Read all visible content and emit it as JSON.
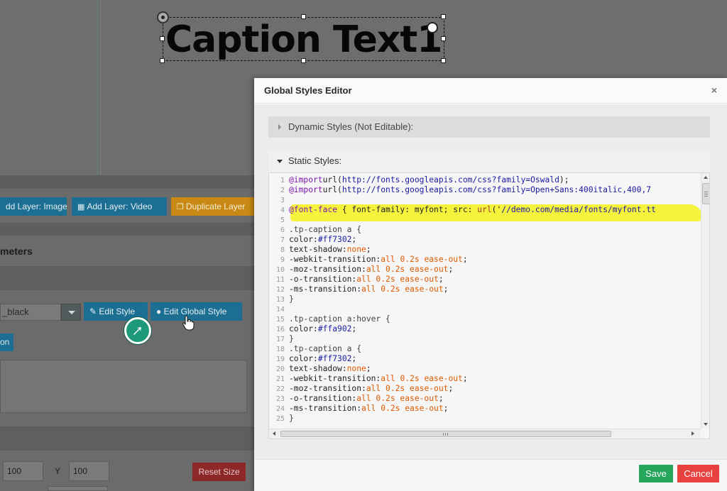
{
  "background": {
    "caption_text": "Caption Text1",
    "toolbar": {
      "add_layer_image": "dd Layer: Image",
      "add_layer_video": "Add Layer: Video",
      "duplicate_layer": "Duplicate Layer"
    },
    "section_title": "meters",
    "style_select_value": "_black",
    "edit_style": "Edit Style",
    "edit_global_style": "Edit Global Style",
    "partial_button": "on",
    "x_value": "100",
    "y_label": "Y",
    "y_value": "100",
    "reset_size": "Reset Size"
  },
  "modal": {
    "title": "Global Styles Editor",
    "close": "×",
    "dynamic_styles": "Dynamic Styles (Not Editable):",
    "static_styles": "Static Styles:",
    "save": "Save",
    "cancel": "Cancel",
    "code_lines": [
      [
        [
          "kw",
          "@import"
        ],
        [
          "",
          "url("
        ],
        [
          "url",
          "http://fonts.googleapis.com/css?family=Oswald"
        ],
        [
          "",
          ");"
        ]
      ],
      [
        [
          "kw",
          "@import"
        ],
        [
          "",
          "url("
        ],
        [
          "url",
          "http://fonts.googleapis.com/css?family=Open+Sans:400italic,400,7"
        ]
      ],
      [],
      [
        [
          "kw",
          "@font-face"
        ],
        [
          "",
          " { font-family: myfont; src: "
        ],
        [
          "str",
          "url"
        ],
        [
          "",
          "('"
        ],
        [
          "url",
          "//demo.com/media/fonts/myfont.tt"
        ]
      ],
      [],
      [
        [
          "sel",
          ".tp-caption a {"
        ]
      ],
      [
        [
          "prop",
          "color:"
        ],
        [
          "url",
          "#ff7302"
        ],
        [
          "",
          ";"
        ]
      ],
      [
        [
          "prop",
          "text-shadow:"
        ],
        [
          "num",
          "none"
        ],
        [
          "",
          ";"
        ]
      ],
      [
        [
          "prop",
          "-webkit-transition:"
        ],
        [
          "num",
          "all 0.2s ease-out"
        ],
        [
          "",
          ";"
        ]
      ],
      [
        [
          "prop",
          "-moz-transition:"
        ],
        [
          "num",
          "all 0.2s ease-out"
        ],
        [
          "",
          ";"
        ]
      ],
      [
        [
          "prop",
          "-o-transition:"
        ],
        [
          "num",
          "all 0.2s ease-out"
        ],
        [
          "",
          ";"
        ]
      ],
      [
        [
          "prop",
          "-ms-transition:"
        ],
        [
          "num",
          "all 0.2s ease-out"
        ],
        [
          "",
          ";"
        ]
      ],
      [
        [
          "sel",
          "}"
        ]
      ],
      [],
      [
        [
          "sel",
          ".tp-caption a:hover {"
        ]
      ],
      [
        [
          "prop",
          "color:"
        ],
        [
          "url",
          "#ffa902"
        ],
        [
          "",
          ";"
        ]
      ],
      [
        [
          "sel",
          "}"
        ]
      ],
      [
        [
          "sel",
          ".tp-caption a {"
        ]
      ],
      [
        [
          "prop",
          "color:"
        ],
        [
          "url",
          "#ff7302"
        ],
        [
          "",
          ";"
        ]
      ],
      [
        [
          "prop",
          "text-shadow:"
        ],
        [
          "num",
          "none"
        ],
        [
          "",
          ";"
        ]
      ],
      [
        [
          "prop",
          "-webkit-transition:"
        ],
        [
          "num",
          "all 0.2s ease-out"
        ],
        [
          "",
          ";"
        ]
      ],
      [
        [
          "prop",
          "-moz-transition:"
        ],
        [
          "num",
          "all 0.2s ease-out"
        ],
        [
          "",
          ";"
        ]
      ],
      [
        [
          "prop",
          "-o-transition:"
        ],
        [
          "num",
          "all 0.2s ease-out"
        ],
        [
          "",
          ";"
        ]
      ],
      [
        [
          "prop",
          "-ms-transition:"
        ],
        [
          "num",
          "all 0.2s ease-out"
        ],
        [
          "",
          ";"
        ]
      ],
      [
        [
          "sel",
          "}"
        ]
      ]
    ],
    "line_numbers": [
      "1",
      "2",
      "3",
      "4",
      "5",
      "6",
      "7",
      "8",
      "9",
      "10",
      "11",
      "12",
      "13",
      "14",
      "15",
      "16",
      "17",
      "18",
      "19",
      "20",
      "21",
      "22",
      "23",
      "24",
      "25"
    ]
  },
  "colors": {
    "save": "#26a65b",
    "cancel": "#e8423f",
    "highlight": "#f5f22c",
    "accent_blue": "#1c6f93"
  }
}
